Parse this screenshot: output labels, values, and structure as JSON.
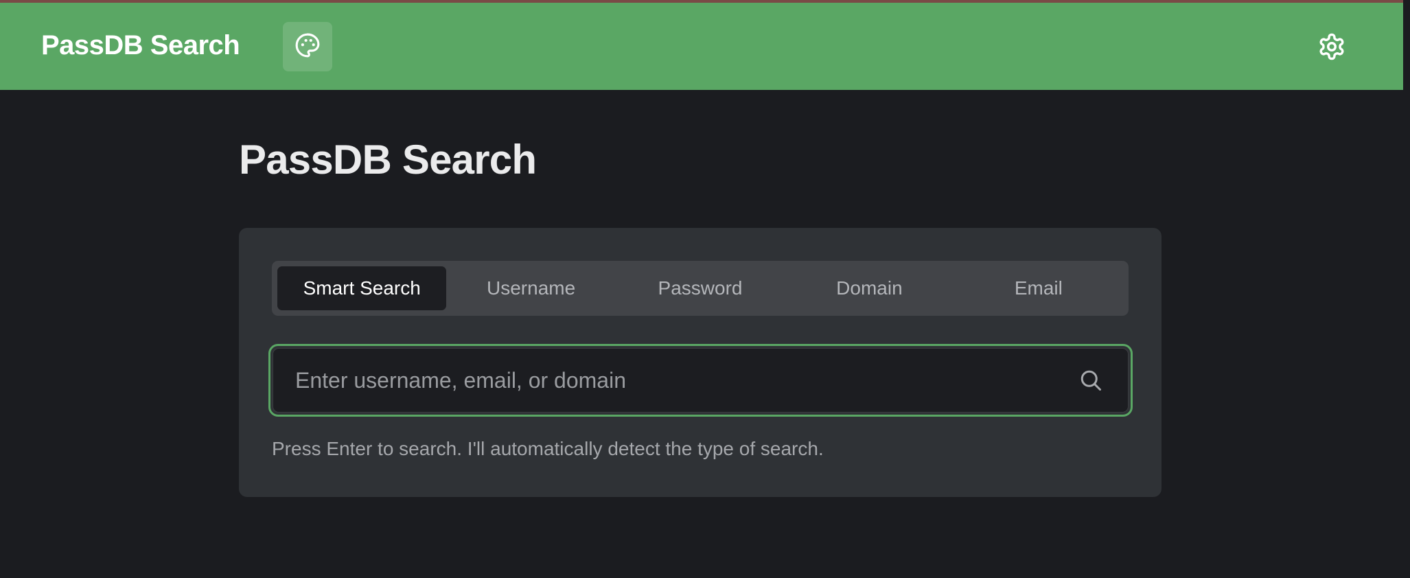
{
  "header": {
    "app_title": "PassDB Search",
    "brand_color": "#5aa764",
    "palette_icon": "palette-icon",
    "settings_icon": "gear-icon"
  },
  "main": {
    "page_title": "PassDB Search",
    "tabs": [
      {
        "label": "Smart Search",
        "active": true
      },
      {
        "label": "Username",
        "active": false
      },
      {
        "label": "Password",
        "active": false
      },
      {
        "label": "Domain",
        "active": false
      },
      {
        "label": "Email",
        "active": false
      }
    ],
    "search": {
      "value": "",
      "placeholder": "Enter username, email, or domain",
      "icon": "search-icon"
    },
    "hint": "Press Enter to search. I'll automatically detect the type of search."
  }
}
